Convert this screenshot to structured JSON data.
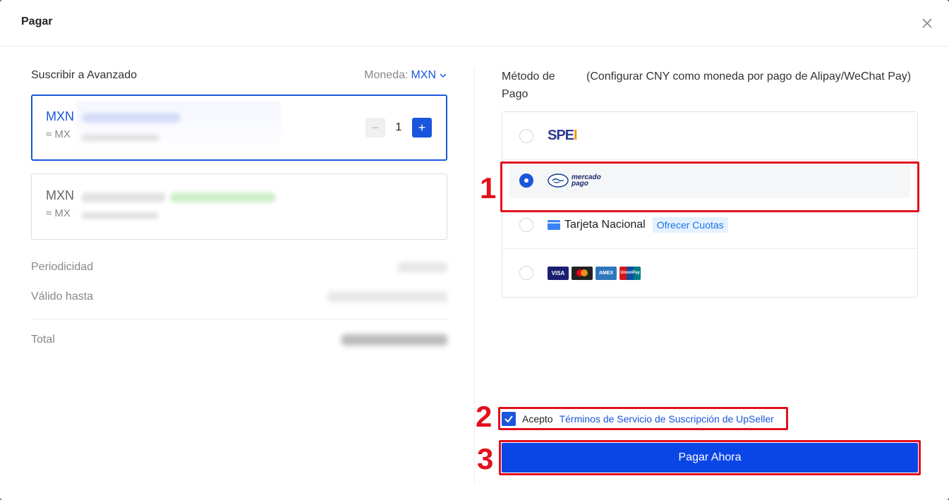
{
  "modal": {
    "title": "Pagar"
  },
  "left": {
    "subscribe_label": "Suscribir a Avanzado",
    "currency_label": "Moneda:",
    "currency_value": "MXN",
    "plans": [
      {
        "price_prefix": "MXN",
        "approx_prefix": "≈ MX",
        "quantity": "1"
      },
      {
        "price_prefix": "MXN",
        "approx_prefix": "≈ MX"
      }
    ],
    "rows": [
      {
        "label": "Periodicidad"
      },
      {
        "label": "Válido hasta"
      }
    ],
    "total_label": "Total"
  },
  "right": {
    "method_title": "Método de Pago",
    "method_note": "(Configurar CNY como moneda por pago de Alipay/WeChat Pay)",
    "options": {
      "spei": {
        "logo_a": "SPE",
        "logo_b": "I"
      },
      "mercado": {
        "logo_line1": "mercado",
        "logo_line2": "pago"
      },
      "tarjeta": {
        "label": "Tarjeta Nacional",
        "badge": "Ofrecer Cuotas"
      },
      "cards": {
        "visa": "VISA",
        "amex": "AMEX",
        "union": "UnionPay"
      }
    },
    "terms_prefix": "Acepto",
    "terms_link": "Términos de Servicio de Suscripción de UpSeller",
    "pay_label": "Pagar Ahora"
  },
  "annotations": [
    "1",
    "2",
    "3"
  ],
  "colors": {
    "accent": "#1a56db",
    "annotation": "#e3101e"
  }
}
